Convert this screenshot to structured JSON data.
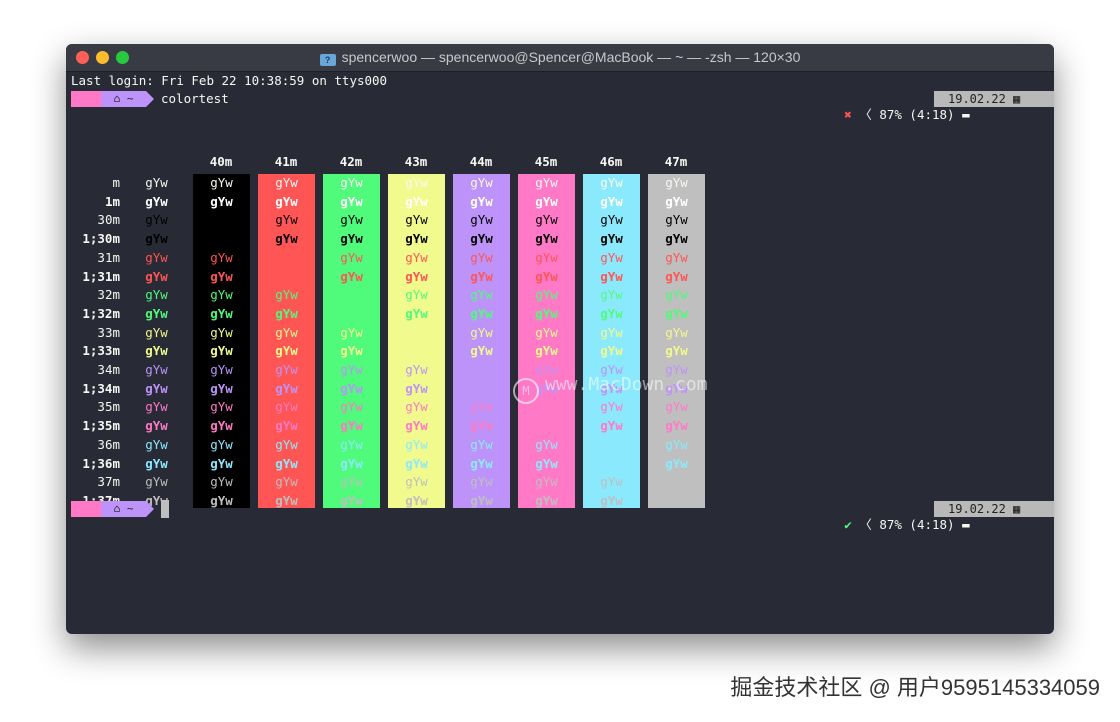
{
  "window": {
    "title": "spencerwoo — spencerwoo@Spencer@MacBook — ~ — -zsh — 120×30",
    "folder_icon": "folder-icon"
  },
  "terminal": {
    "last_login": "Last login: Fri Feb 22 10:38:59 on ttys000",
    "prompt_icon_home": "home-icon",
    "prompt_dir": "~",
    "command": "colortest",
    "status_fail_glyph": "✖",
    "status_ok_glyph": "✔",
    "battery": "87% (4:18)",
    "date": "19.02.22",
    "colors": {
      "bg": "#282a36",
      "pink": "#ff79c6",
      "purple": "#bd93f9",
      "fail": "#ff5555",
      "ok": "#50fa7b"
    }
  },
  "colortest": {
    "sample": "gYw",
    "columns": [
      "40m",
      "41m",
      "42m",
      "43m",
      "44m",
      "45m",
      "46m",
      "47m"
    ],
    "column_bgs": [
      "#000000",
      "#ff5555",
      "#50fa7b",
      "#f1fa8c",
      "#bd93f9",
      "#ff79c6",
      "#8be9fd",
      "#bfbfbf"
    ],
    "rows": [
      {
        "label": "m",
        "fg": "#f8f8f2",
        "bold": false
      },
      {
        "label": "1m",
        "fg": "#ffffff",
        "bold": true
      },
      {
        "label": "30m",
        "fg": "#000000",
        "bold": false
      },
      {
        "label": "1;30m",
        "fg": "#000000",
        "bold": true
      },
      {
        "label": "31m",
        "fg": "#ff5555",
        "bold": false
      },
      {
        "label": "1;31m",
        "fg": "#ff5555",
        "bold": true
      },
      {
        "label": "32m",
        "fg": "#50fa7b",
        "bold": false
      },
      {
        "label": "1;32m",
        "fg": "#50fa7b",
        "bold": true
      },
      {
        "label": "33m",
        "fg": "#f1fa8c",
        "bold": false
      },
      {
        "label": "1;33m",
        "fg": "#f1fa8c",
        "bold": true
      },
      {
        "label": "34m",
        "fg": "#bd93f9",
        "bold": false
      },
      {
        "label": "1;34m",
        "fg": "#bd93f9",
        "bold": true
      },
      {
        "label": "35m",
        "fg": "#ff79c6",
        "bold": false
      },
      {
        "label": "1;35m",
        "fg": "#ff79c6",
        "bold": true
      },
      {
        "label": "36m",
        "fg": "#8be9fd",
        "bold": false
      },
      {
        "label": "1;36m",
        "fg": "#8be9fd",
        "bold": true
      },
      {
        "label": "37m",
        "fg": "#bfbfbf",
        "bold": false
      },
      {
        "label": "1;37m",
        "fg": "#bfbfbf",
        "bold": true
      }
    ]
  },
  "watermark_center": "www.MacDown.com",
  "watermark_footer": "掘金技术社区 @ 用户9595145334059"
}
